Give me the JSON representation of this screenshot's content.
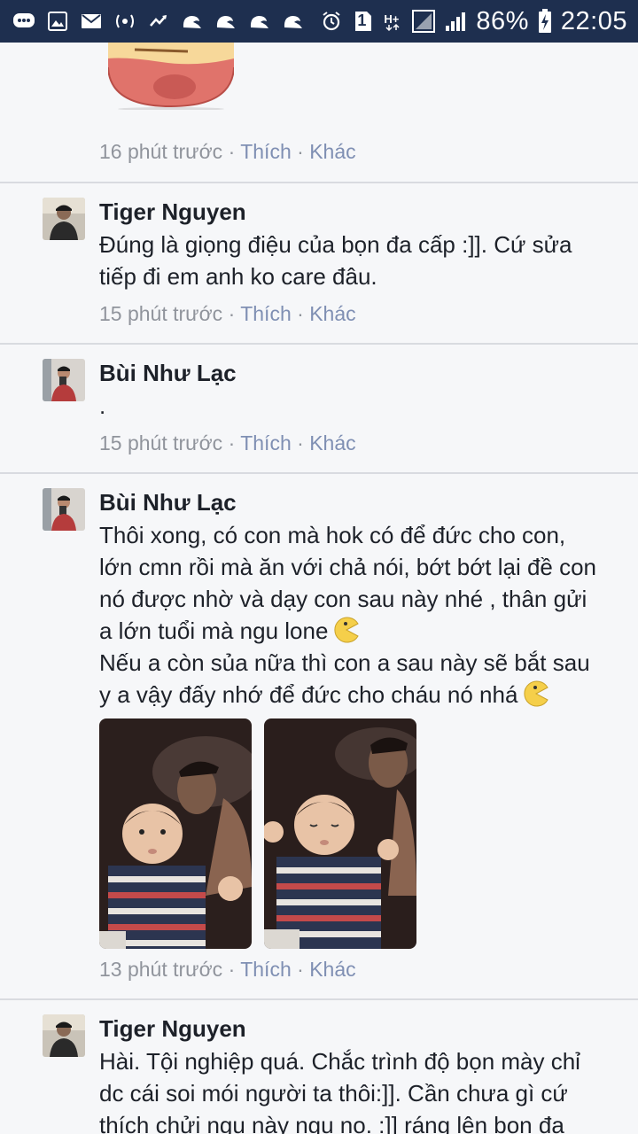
{
  "status_bar": {
    "battery_percent": "86%",
    "time": "22:05",
    "network": "H+",
    "sim_badge": "1",
    "colors": {
      "background": "#1e2f4f",
      "foreground": "#ffffff"
    }
  },
  "comments": [
    {
      "meta": {
        "time": "16 phút trước",
        "like": "Thích",
        "more": "Khác"
      }
    },
    {
      "author": "Tiger Nguyen",
      "avatar_icon": "avatar-icon",
      "text_lines": [
        "Đúng là giọng điệu của bọn đa cấp :]]. Cứ sửa",
        "tiếp đi em anh ko care đâu."
      ],
      "meta": {
        "time": "15 phút trước",
        "like": "Thích",
        "more": "Khác"
      }
    },
    {
      "author": "Bùi Như Lạc",
      "avatar_icon": "avatar-icon",
      "text_lines": [
        "."
      ],
      "meta": {
        "time": "15 phút trước",
        "like": "Thích",
        "more": "Khác"
      }
    },
    {
      "author": "Bùi Như Lạc",
      "avatar_icon": "avatar-icon",
      "text_lines": [
        "Thôi xong, có con mà hok có để đức cho con,",
        "lớn cmn rồi mà ăn với chả nói, bớt bớt lại đề con",
        "nó được nhờ và dạy con sau này nhé , thân gửi",
        "a lớn tuổi mà ngu lone",
        "Nếu a còn sủa nữa thì con a sau này sẽ bắt sau",
        "y a vậy đấy nhớ để đức cho cháu nó nhá"
      ],
      "meta": {
        "time": "13 phút trước",
        "like": "Thích",
        "more": "Khác"
      }
    },
    {
      "author": "Tiger Nguyen",
      "avatar_icon": "avatar-icon",
      "text_lines": [
        "Hài. Tội nghiệp quá. Chắc trình độ bọn mày chỉ",
        "dc cái soi mói người ta thôi:]]. Cần chưa gì cứ",
        "thích chửi ngu này ngu no. :]] ráng lên bọn đa"
      ]
    }
  ],
  "separator": "·",
  "colors": {
    "page_background": "#f6f7f9",
    "text": "#1d2129",
    "meta_text": "#90949c",
    "link_text": "#7f8fb3",
    "divider": "#d9dbe0"
  }
}
